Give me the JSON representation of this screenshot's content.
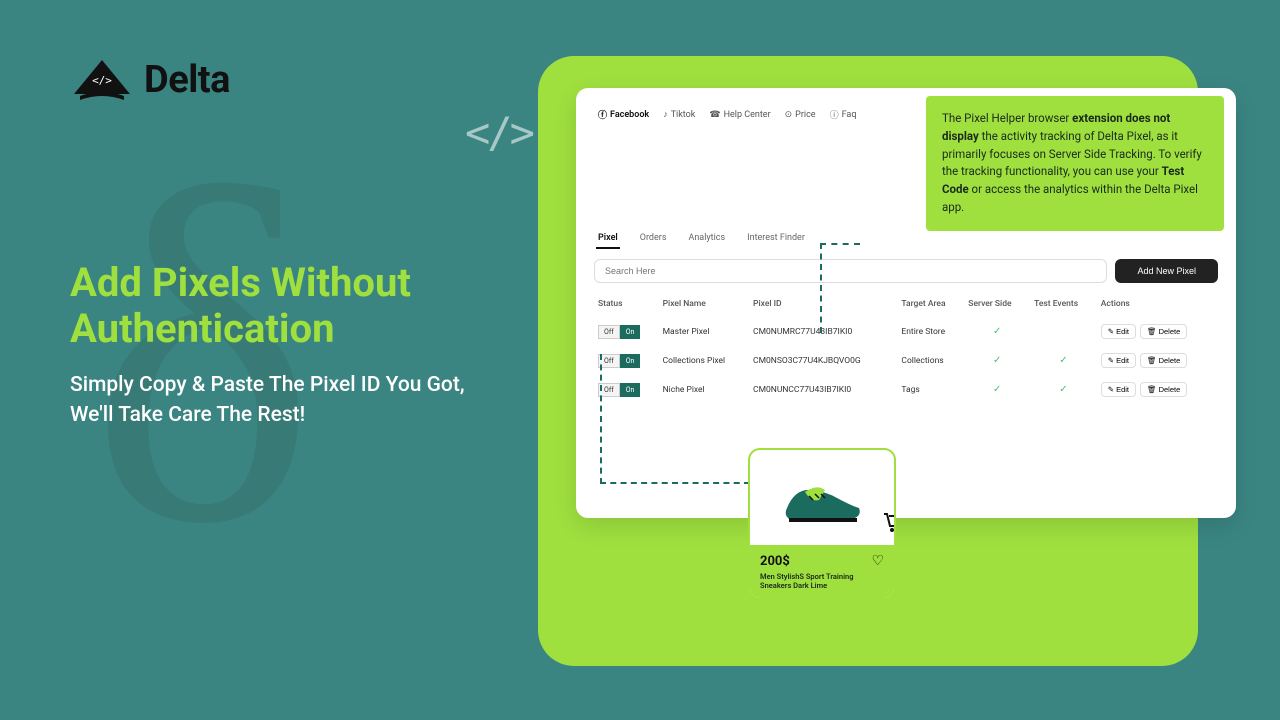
{
  "brand": {
    "name": "Delta"
  },
  "hero": {
    "title": "Add Pixels Without Authentication",
    "subtitle": "Simply Copy & Paste The Pixel ID You Got, We'll Take Care The Rest!"
  },
  "topnav": {
    "items": [
      {
        "label": "Facebook",
        "active": true
      },
      {
        "label": "Tiktok"
      },
      {
        "label": "Help Center"
      },
      {
        "label": "Price"
      },
      {
        "label": "Faq"
      }
    ]
  },
  "tabs": {
    "items": [
      {
        "label": "Pixel",
        "active": true
      },
      {
        "label": "Orders"
      },
      {
        "label": "Analytics"
      },
      {
        "label": "Interest Finder"
      }
    ]
  },
  "search": {
    "placeholder": "Search Here"
  },
  "add_button": "Add New Pixel",
  "table": {
    "headers": [
      "Status",
      "Pixel Name",
      "Pixel ID",
      "Target Area",
      "Server Side",
      "Test Events",
      "Actions"
    ],
    "toggle_off": "Off",
    "toggle_on": "On",
    "edit_label": "Edit",
    "delete_label": "Delete",
    "rows": [
      {
        "name": "Master Pixel",
        "id": "CM0NUMRC77U43IB7IKI0",
        "target": "Entire Store",
        "server": true,
        "test": false
      },
      {
        "name": "Collections Pixel",
        "id": "CM0NSO3C77U4KJBQVO0G",
        "target": "Collections",
        "server": true,
        "test": true
      },
      {
        "name": "Niche Pixel",
        "id": "CM0NUNCC77U43IB7IKI0",
        "target": "Tags",
        "server": true,
        "test": true
      }
    ]
  },
  "callout": {
    "parts": [
      "The Pixel Helper browser ",
      "extension does not display",
      " the activity tracking of Delta Pixel, as it primarily focuses on Server Side Tracking. To verify the tracking functionality, you can use your ",
      "Test Code",
      " or access the analytics within the Delta Pixel app."
    ]
  },
  "product": {
    "price": "200$",
    "desc": "Men StylishS Sport Training Sneakers Dark Lime"
  }
}
